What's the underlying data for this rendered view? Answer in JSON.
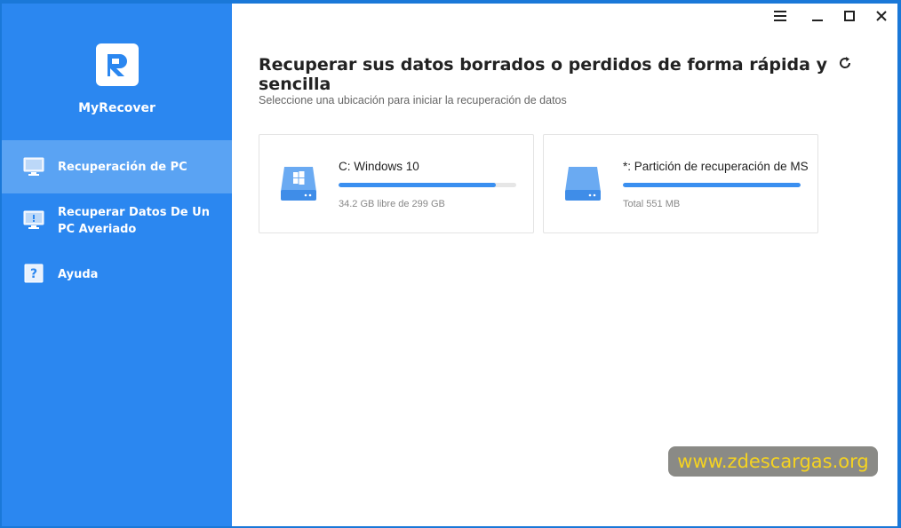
{
  "app": {
    "name": "MyRecover"
  },
  "sidebar": {
    "items": [
      {
        "label": "Recuperación de PC",
        "active": true,
        "icon": "monitor-icon"
      },
      {
        "label": "Recuperar Datos De Un PC Averiado",
        "active": false,
        "icon": "monitor-alert-icon"
      },
      {
        "label": "Ayuda",
        "active": false,
        "icon": "help-icon"
      }
    ]
  },
  "window_controls": [
    "menu-icon",
    "minimize-icon",
    "maximize-icon",
    "close-icon"
  ],
  "main": {
    "title": "Recuperar sus datos borrados o perdidos de forma rápida y sencilla",
    "subtitle": "Seleccione una ubicación para iniciar la recuperación de datos"
  },
  "drives": [
    {
      "name": "C: Windows 10",
      "info": "34.2 GB libre de 299 GB",
      "used_fraction": 0.886,
      "icon": "windows-drive-icon"
    },
    {
      "name": "*: Partición de recuperación de MS",
      "info": "Total 551 MB",
      "used_fraction": 1.0,
      "icon": "drive-icon"
    }
  ],
  "watermark": "www.zdescargas.org",
  "colors": {
    "sidebar": "#2b87f0",
    "sidebar_active": "#5aa3f3",
    "accent": "#3a8ff0",
    "watermark_text": "#f5d321"
  }
}
